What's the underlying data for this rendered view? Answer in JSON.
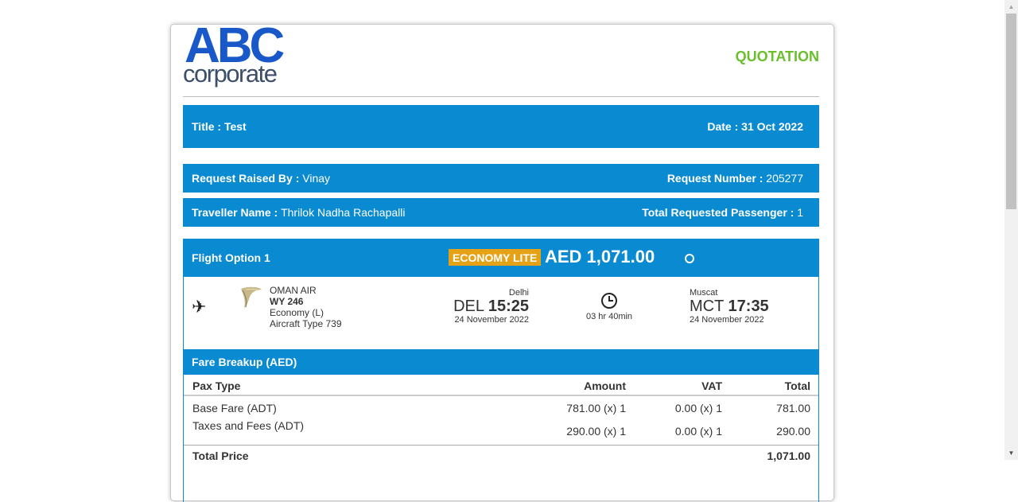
{
  "logo": {
    "line1": "ABC",
    "line2": "corporate"
  },
  "heading": "QUOTATION",
  "title_bar": {
    "title_label": "Title",
    "title_value": ": Test",
    "date_label": "Date : ",
    "date_value": "31 Oct 2022"
  },
  "request_bar": {
    "raised_label": "Request Raised By : ",
    "raised_value": "Vinay",
    "number_label": "Request Number : ",
    "number_value": "205277"
  },
  "traveller_bar": {
    "name_label": "Traveller Name : ",
    "name_value": "Thrilok Nadha Rachapalli",
    "pax_label": "Total Requested Passenger : ",
    "pax_value": "1"
  },
  "option": {
    "label": "Flight Option 1",
    "fare_class": "ECONOMY LITE",
    "price": "AED 1,071.00"
  },
  "flight": {
    "airline": "OMAN AIR",
    "flight_no": "WY 246",
    "cabin": "Economy (L)",
    "aircraft": "Aircraft Type 739",
    "dep": {
      "city": "Delhi",
      "code": "DEL",
      "time": "15:25",
      "date": "24 November 2022"
    },
    "duration": "03 hr 40min",
    "arr": {
      "city": "Muscat",
      "code": "MCT",
      "time": "17:35",
      "date": "24 November 2022"
    }
  },
  "fare": {
    "title": "Fare Breakup (AED)",
    "headers": [
      "Pax Type",
      "Amount",
      "VAT",
      "Total"
    ],
    "rows": [
      [
        "Base Fare (ADT)",
        "781.00 (x) 1",
        "0.00 (x) 1",
        "781.00"
      ],
      [
        "Taxes and Fees (ADT)",
        "290.00 (x) 1",
        "0.00 (x) 1",
        "290.00"
      ]
    ],
    "total_label": "Total Price",
    "total_value": "1,071.00"
  }
}
